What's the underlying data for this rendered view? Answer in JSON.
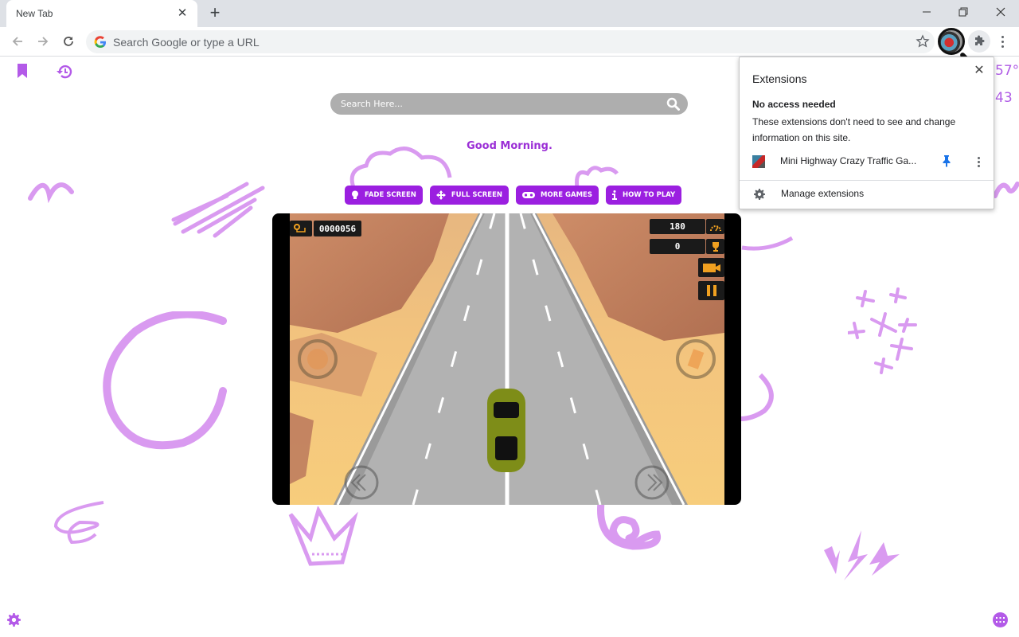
{
  "browser": {
    "tab_title": "New Tab",
    "tab_close_icon": "close-icon",
    "new_tab_icon": "plus-icon",
    "window_controls": [
      "minimize-icon",
      "restore-icon",
      "close-icon"
    ],
    "omnibox_placeholder": "Search Google or type a URL"
  },
  "page": {
    "search_placeholder": "Search Here...",
    "greeting": "Good Morning.",
    "actions": [
      {
        "label": "FADE SCREEN",
        "icon": "lightbulb-icon"
      },
      {
        "label": "FULL SCREEN",
        "icon": "move-arrows-icon"
      },
      {
        "label": "MORE GAMES",
        "icon": "gamepad-icon"
      },
      {
        "label": "HOW TO PLAY",
        "icon": "info-icon"
      }
    ],
    "weather": {
      "temperature": "57°",
      "secondary": "43"
    },
    "accent_color": "#9b1fe0"
  },
  "game": {
    "distance": "0000056",
    "speed": "180",
    "score": "0"
  },
  "extensions_popup": {
    "title": "Extensions",
    "section_title": "No access needed",
    "section_desc": "These extensions don't need to see and change information on this site.",
    "extension_name": "Mini Highway Crazy Traffic Ga...",
    "manage_label": "Manage extensions"
  }
}
